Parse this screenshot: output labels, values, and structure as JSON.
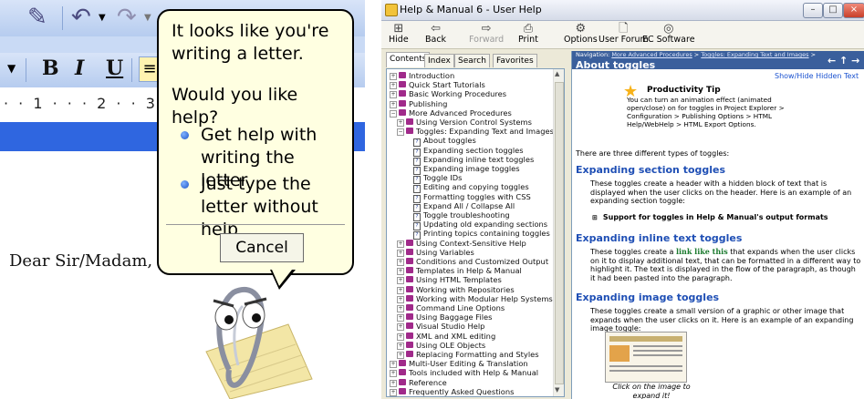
{
  "left_panel": {
    "clippy_bubble": {
      "intro": "It looks like you're writing a letter.",
      "question": "Would you like help?",
      "options": [
        "Get help with writing the letter",
        "Just type the letter without help"
      ],
      "cancel_label": "Cancel"
    },
    "format_buttons": {
      "bold": "B",
      "italic": "I",
      "underline": "U"
    },
    "ruler_text": "· · 1 · · · 2 · · 3",
    "document_text": "Dear Sir/Madam,"
  },
  "help_window": {
    "title": "Help & Manual 6 - User Help",
    "window_controls": {
      "minimize": "–",
      "maximize": "□",
      "close": "×"
    },
    "toolbar": [
      {
        "label": "Hide",
        "icon": "hide-icon",
        "glyph": "⊞",
        "enabled": true
      },
      {
        "label": "Back",
        "icon": "back-arrow-icon",
        "glyph": "⇦",
        "enabled": true
      },
      {
        "label": "Forward",
        "icon": "forward-arrow-icon",
        "glyph": "⇨",
        "enabled": false
      },
      {
        "label": "Print",
        "icon": "print-icon",
        "glyph": "⎙",
        "enabled": true
      },
      {
        "label": "Options",
        "icon": "options-icon",
        "glyph": "⚙",
        "enabled": true
      },
      {
        "label": "User Forum",
        "icon": "forum-icon",
        "glyph": "🗋",
        "enabled": true
      },
      {
        "label": "EC Software",
        "icon": "ec-software-icon",
        "glyph": "◎",
        "enabled": true
      }
    ],
    "tabs": [
      "Contents",
      "Index",
      "Search",
      "Favorites"
    ],
    "active_tab": "Contents",
    "tree": [
      {
        "label": "Introduction",
        "level": 0,
        "type": "book",
        "toggle": "+"
      },
      {
        "label": "Quick Start Tutorials",
        "level": 0,
        "type": "book",
        "toggle": "+"
      },
      {
        "label": "Basic Working Procedures",
        "level": 0,
        "type": "book",
        "toggle": "+"
      },
      {
        "label": "Publishing",
        "level": 0,
        "type": "book",
        "toggle": "+"
      },
      {
        "label": "More Advanced Procedures",
        "level": 0,
        "type": "book",
        "toggle": "-"
      },
      {
        "label": "Using Version Control Systems",
        "level": 1,
        "type": "book",
        "toggle": "+"
      },
      {
        "label": "Toggles: Expanding Text and Images",
        "level": 1,
        "type": "book",
        "toggle": "-"
      },
      {
        "label": "About toggles",
        "level": 2,
        "type": "page",
        "toggle": ""
      },
      {
        "label": "Expanding section toggles",
        "level": 2,
        "type": "page",
        "toggle": ""
      },
      {
        "label": "Expanding inline text toggles",
        "level": 2,
        "type": "page",
        "toggle": ""
      },
      {
        "label": "Expanding image toggles",
        "level": 2,
        "type": "page",
        "toggle": ""
      },
      {
        "label": "Toggle IDs",
        "level": 2,
        "type": "page",
        "toggle": ""
      },
      {
        "label": "Editing and copying toggles",
        "level": 2,
        "type": "page",
        "toggle": ""
      },
      {
        "label": "Formatting toggles with CSS",
        "level": 2,
        "type": "page",
        "toggle": ""
      },
      {
        "label": "Expand All / Collapse All",
        "level": 2,
        "type": "page",
        "toggle": ""
      },
      {
        "label": "Toggle troubleshooting",
        "level": 2,
        "type": "page",
        "toggle": ""
      },
      {
        "label": "Updating old expanding sections",
        "level": 2,
        "type": "page",
        "toggle": ""
      },
      {
        "label": "Printing topics containing toggles",
        "level": 2,
        "type": "page",
        "toggle": ""
      },
      {
        "label": "Using Context-Sensitive Help",
        "level": 1,
        "type": "book",
        "toggle": "+"
      },
      {
        "label": "Using Variables",
        "level": 1,
        "type": "book",
        "toggle": "+"
      },
      {
        "label": "Conditions and Customized Output",
        "level": 1,
        "type": "book",
        "toggle": "+"
      },
      {
        "label": "Templates in Help & Manual",
        "level": 1,
        "type": "book",
        "toggle": "+"
      },
      {
        "label": "Using HTML Templates",
        "level": 1,
        "type": "book",
        "toggle": "+"
      },
      {
        "label": "Working with Repositories",
        "level": 1,
        "type": "book",
        "toggle": "+"
      },
      {
        "label": "Working with Modular Help Systems",
        "level": 1,
        "type": "book",
        "toggle": "+"
      },
      {
        "label": "Command Line Options",
        "level": 1,
        "type": "book",
        "toggle": "+"
      },
      {
        "label": "Using Baggage Files",
        "level": 1,
        "type": "book",
        "toggle": "+"
      },
      {
        "label": "Visual Studio Help",
        "level": 1,
        "type": "book",
        "toggle": "+"
      },
      {
        "label": "XML and XML editing",
        "level": 1,
        "type": "book",
        "toggle": "+"
      },
      {
        "label": "Using OLE Objects",
        "level": 1,
        "type": "book",
        "toggle": "+"
      },
      {
        "label": "Replacing Formatting and Styles",
        "level": 1,
        "type": "book",
        "toggle": "+"
      },
      {
        "label": "Multi-User Editing & Translation",
        "level": 0,
        "type": "book",
        "toggle": "+"
      },
      {
        "label": "Tools included with Help & Manual",
        "level": 0,
        "type": "book",
        "toggle": "+"
      },
      {
        "label": "Reference",
        "level": 0,
        "type": "book",
        "toggle": "+"
      },
      {
        "label": "Frequently Asked Questions",
        "level": 0,
        "type": "book",
        "toggle": "+"
      }
    ],
    "content": {
      "nav_prefix": "Navigation:",
      "breadcrumb": [
        "More Advanced Procedures",
        "Toggles: Expanding Text and Images"
      ],
      "breadcrumb_sep": " > ",
      "title": "About toggles",
      "nav_arrows": "← ↑ →",
      "show_hide": "Show/Hide Hidden Text",
      "tip_title": "Productivity Tip",
      "tip_body": "You can turn an animation effect (animated open/close) on for toggles in Project Explorer > Configuration > Publishing Options > HTML Help/WebHelp > HTML Export Options.",
      "intro": "There are three different types of toggles:",
      "section1_heading": "Expanding section toggles",
      "section1_text": "These toggles create a header with a hidden block of text that is displayed when the user clicks on the header. Here is an example of an expanding section toggle:",
      "section1_example": "Support for toggles in Help & Manual's output formats",
      "section2_heading": "Expanding inline text toggles",
      "section2_text_before": "These toggles create a ",
      "section2_link": "link like this",
      "section2_text_after": " that expands when the user clicks on it to display additional text, that can be formatted in a different way to highlight it. The text is displayed in the flow of the paragraph, as though it had been pasted into the paragraph.",
      "section3_heading": "Expanding image toggles",
      "section3_text": "These toggles create a small version of a graphic or other image that expands when the user clicks on it. Here is an example of an expanding image toggle:",
      "image_caption": "Click on the image to expand it!"
    }
  }
}
